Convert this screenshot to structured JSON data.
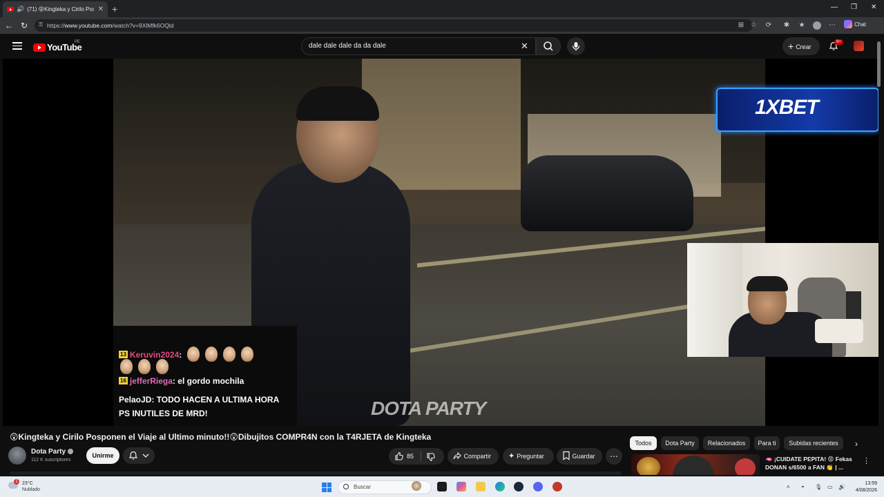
{
  "browser": {
    "tab_title": "(71) 😲Kingteka y Cirilo Pospo",
    "url_prefix": "https://",
    "url_host": "www.youtube.com",
    "url_path": "/watch?v=9XlMfk6OQld",
    "chat_label": "Chat"
  },
  "youtube": {
    "logo_text": "YouTube",
    "region": "PE",
    "search_value": "dale dale dale da da dale",
    "create_label": "Crear",
    "notification_count": "9+"
  },
  "video": {
    "chat": [
      {
        "badge": "13",
        "user": "Keruvin2024",
        "message": ":"
      },
      {
        "badge": "16",
        "user": "jefferRiega",
        "message": ": el gordo mochila"
      },
      {
        "badge": "",
        "user": "PelaoJD",
        "message": ": TODO HACEN A ULTIMA HORA"
      },
      {
        "badge": "",
        "user": "",
        "message": "PS INUTILES DE MRD!"
      }
    ],
    "watermark": "DOTA PARTY",
    "ad_text": "1XBET"
  },
  "details": {
    "title": "😲Kingteka y Cirilo Posponen el Viaje al Ultimo minuto!!😲Dibujitos COMPR4N con la T4RJETA de Kingteka",
    "channel_name": "Dota Party",
    "subscribers": "112 K suscriptores",
    "join_label": "Unirme",
    "likes": "85",
    "share_label": "Compartir",
    "ask_label": "Preguntar",
    "save_label": "Guardar"
  },
  "chips": [
    "Todos",
    "Dota Party",
    "Relacionados",
    "Para ti",
    "Subidas recientes"
  ],
  "recommendation": {
    "title": "🫦 ¡CUIDATE PEPITA! 😡 Fekas DONAN s/6500 a FAN 👏 | ..."
  },
  "taskbar": {
    "weather_badge": "1",
    "temperature": "23°C",
    "condition": "Nublado",
    "search_placeholder": "Buscar",
    "time": "13:59",
    "date": "4/08/2026"
  }
}
